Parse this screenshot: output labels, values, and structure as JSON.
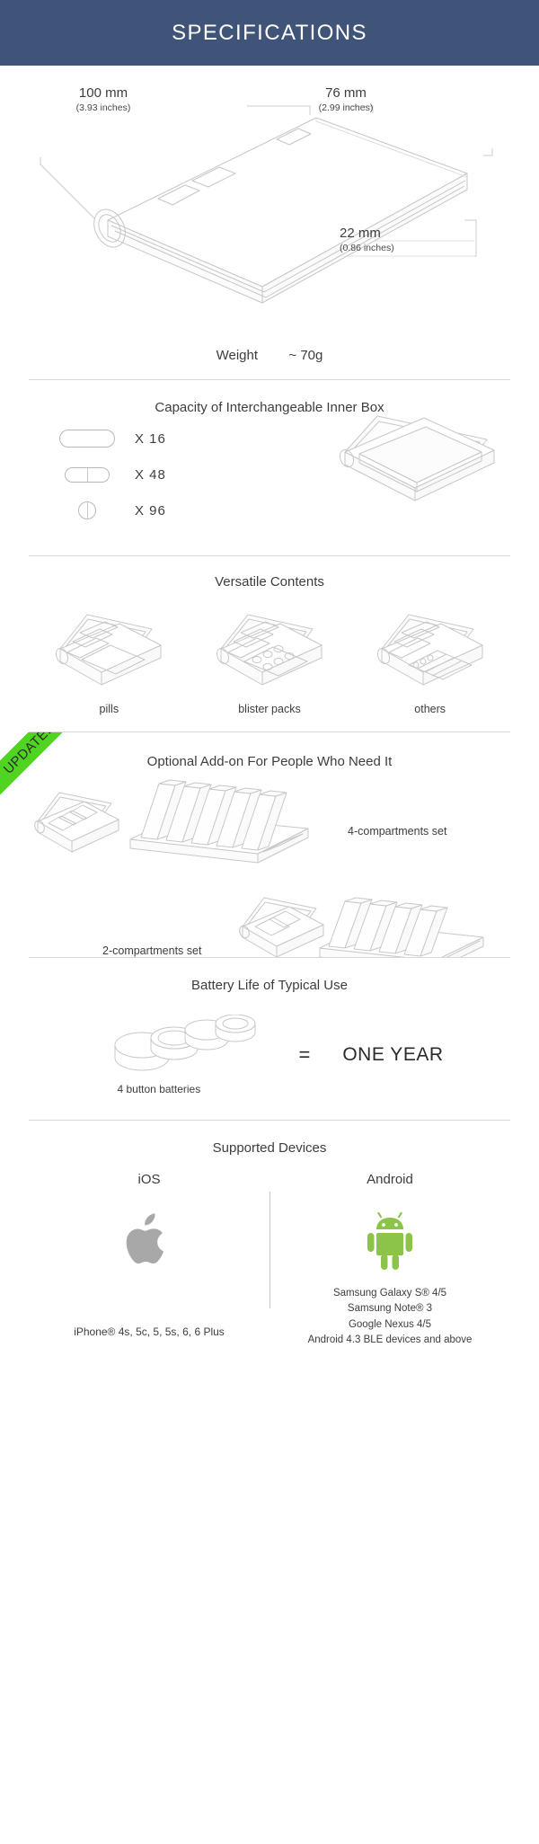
{
  "header": {
    "title": "SPECIFICATIONS",
    "bg_color": "#3f5478",
    "text_color": "#ffffff"
  },
  "dimensions": {
    "length": {
      "value": "100 mm",
      "inches": "(3.93 inches)"
    },
    "width": {
      "value": "76 mm",
      "inches": "(2.99 inches)"
    },
    "height": {
      "value": "22 mm",
      "inches": "(0.86 inches)"
    },
    "weight_label": "Weight",
    "weight_value": "~  70g"
  },
  "capacity": {
    "title": "Capacity of Interchangeable Inner Box",
    "rows": [
      {
        "shape": "capsule-large-icon",
        "count": "X  16"
      },
      {
        "shape": "capsule-medium-icon",
        "count": "X  48"
      },
      {
        "shape": "tablet-round-icon",
        "count": "X  96"
      }
    ]
  },
  "versatile": {
    "title": "Versatile Contents",
    "items": [
      {
        "caption": "pills",
        "icon": "open-box-pills-icon"
      },
      {
        "caption": "blister packs",
        "icon": "open-box-blister-icon"
      },
      {
        "caption": "others",
        "icon": "open-box-others-icon"
      }
    ]
  },
  "addon": {
    "ribbon": "UPDATED",
    "title": "Optional Add-on For People Who Need It",
    "sets": [
      {
        "label": "4-compartments set",
        "icon": "four-compartment-tray-icon"
      },
      {
        "label": "2-compartments set",
        "icon": "two-compartment-tray-icon"
      }
    ]
  },
  "battery": {
    "title": "Battery Life of Typical Use",
    "caption": "4 button batteries",
    "equals": "=",
    "result": "ONE YEAR",
    "count": 4
  },
  "devices": {
    "title": "Supported Devices",
    "ios": {
      "name": "iOS",
      "logo": "apple-logo-icon",
      "logo_color": "#a8a8a8",
      "models": "iPhone®  4s, 5c, 5, 5s, 6, 6 Plus"
    },
    "android": {
      "name": "Android",
      "logo": "android-robot-icon",
      "logo_color": "#8cc349",
      "models": [
        "Samsung Galaxy S® 4/5",
        "Samsung Note® 3",
        "Google Nexus 4/5",
        "Android 4.3 BLE devices and above"
      ]
    }
  },
  "colors": {
    "header_blue": "#3f5478",
    "ribbon_green": "#4ed421",
    "android_green": "#8cc349",
    "apple_grey": "#a8a8a8",
    "line_grey": "#c9c9c9",
    "text": "#3d3d3d"
  }
}
